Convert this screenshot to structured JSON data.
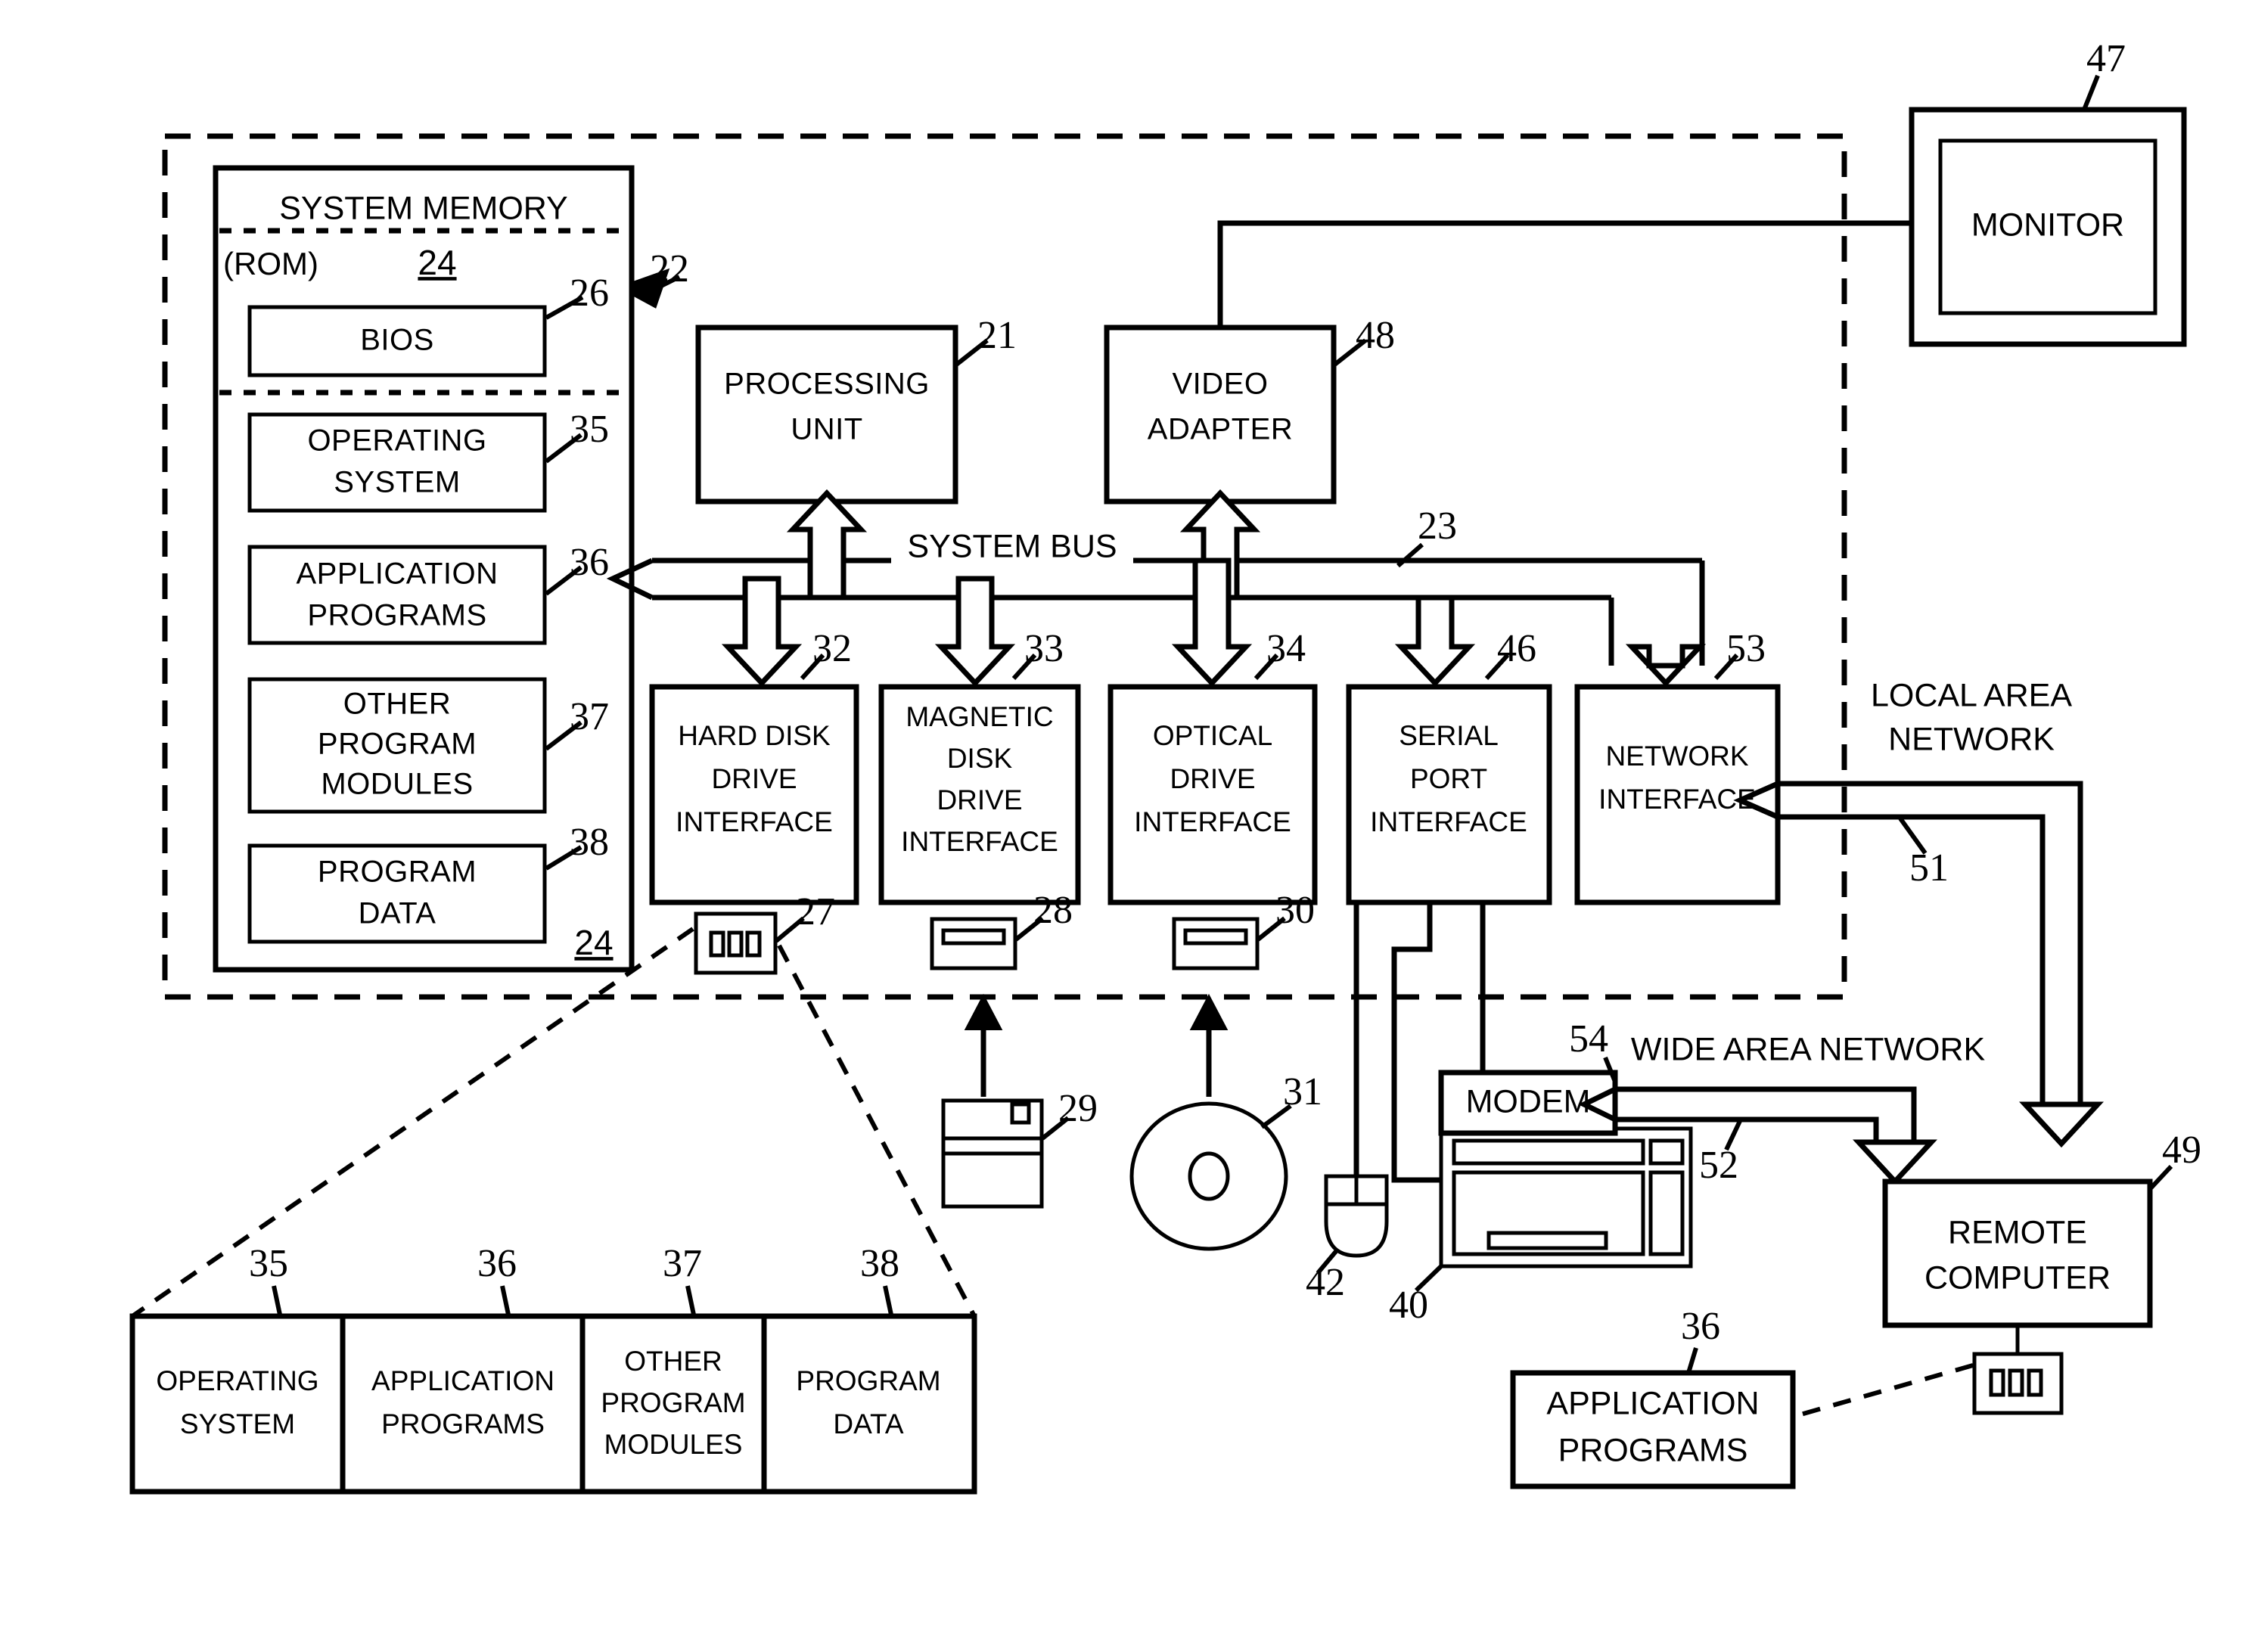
{
  "figure": {
    "type": "patent-block-diagram",
    "title": "Computer system block diagram"
  },
  "boxes": {
    "system_memory": {
      "label": "SYSTEM MEMORY",
      "ref": "24"
    },
    "rom": {
      "label": "(ROM)",
      "ref": "24"
    },
    "bios": {
      "label": "BIOS",
      "ref": "26"
    },
    "operating_system": {
      "line1": "OPERATING",
      "line2": "SYSTEM",
      "ref": "35"
    },
    "application_programs": {
      "line1": "APPLICATION",
      "line2": "PROGRAMS",
      "ref": "36"
    },
    "other_program_modules": {
      "line1": "OTHER",
      "line2": "PROGRAM",
      "line3": "MODULES",
      "ref": "37"
    },
    "program_data": {
      "line1": "PROGRAM",
      "line2": "DATA",
      "ref": "38"
    },
    "processing_unit": {
      "line1": "PROCESSING",
      "line2": "UNIT",
      "ref": "21"
    },
    "video_adapter": {
      "line1": "VIDEO",
      "line2": "ADAPTER",
      "ref": "48"
    },
    "monitor": {
      "label": "MONITOR",
      "ref": "47"
    },
    "hard_disk_drive_interface": {
      "line1": "HARD DISK",
      "line2": "DRIVE",
      "line3": "INTERFACE",
      "ref": "32"
    },
    "magnetic_disk_drive_interface": {
      "line1": "MAGNETIC",
      "line2": "DISK",
      "line3": "DRIVE",
      "line4": "INTERFACE",
      "ref": "33"
    },
    "optical_drive_interface": {
      "line1": "OPTICAL",
      "line2": "DRIVE",
      "line3": "INTERFACE",
      "ref": "34"
    },
    "serial_port_interface": {
      "line1": "SERIAL",
      "line2": "PORT",
      "line3": "INTERFACE",
      "ref": "46"
    },
    "network_interface": {
      "line1": "NETWORK",
      "line2": "INTERFACE",
      "ref": "53"
    },
    "modem": {
      "label": "MODEM",
      "ref": "54"
    },
    "remote_computer": {
      "line1": "REMOTE",
      "line2": "COMPUTER",
      "ref": "49"
    },
    "remote_application_programs": {
      "line1": "APPLICATION",
      "line2": "PROGRAMS",
      "ref": "36"
    }
  },
  "bus": {
    "label": "SYSTEM BUS",
    "ref": "23"
  },
  "networks": {
    "lan_line1": "LOCAL AREA",
    "lan_line2": "NETWORK",
    "lan_ref": "51",
    "wan": "WIDE AREA NETWORK",
    "wan_ref": "52"
  },
  "media": {
    "hard_disk": {
      "name": "hard-disk-icon",
      "ref": "27"
    },
    "magnetic_disk_drive": {
      "name": "floppy-drive-icon",
      "ref": "28"
    },
    "optical_drive": {
      "name": "optical-drive-icon",
      "ref": "30"
    },
    "floppy_disk": {
      "name": "floppy-disk-icon",
      "ref": "29"
    },
    "optical_disc": {
      "name": "optical-disc-icon",
      "ref": "31"
    },
    "mouse": {
      "name": "mouse-icon",
      "ref": "42"
    },
    "keyboard": {
      "name": "keyboard-icon",
      "ref": "40"
    },
    "remote_storage": {
      "name": "remote-hard-disk-icon",
      "ref": ""
    }
  },
  "refs": {
    "computer_boundary": "22"
  },
  "expanded_storage": {
    "cells": [
      {
        "line1": "OPERATING",
        "line2": "SYSTEM",
        "ref": "35"
      },
      {
        "line1": "APPLICATION",
        "line2": "PROGRAMS",
        "ref": "36"
      },
      {
        "line1": "OTHER",
        "line2": "PROGRAM",
        "line3": "MODULES",
        "ref": "37"
      },
      {
        "line1": "PROGRAM",
        "line2": "DATA",
        "ref": "38"
      }
    ]
  },
  "colors": {
    "ink": "#000000",
    "paper": "#ffffff"
  }
}
